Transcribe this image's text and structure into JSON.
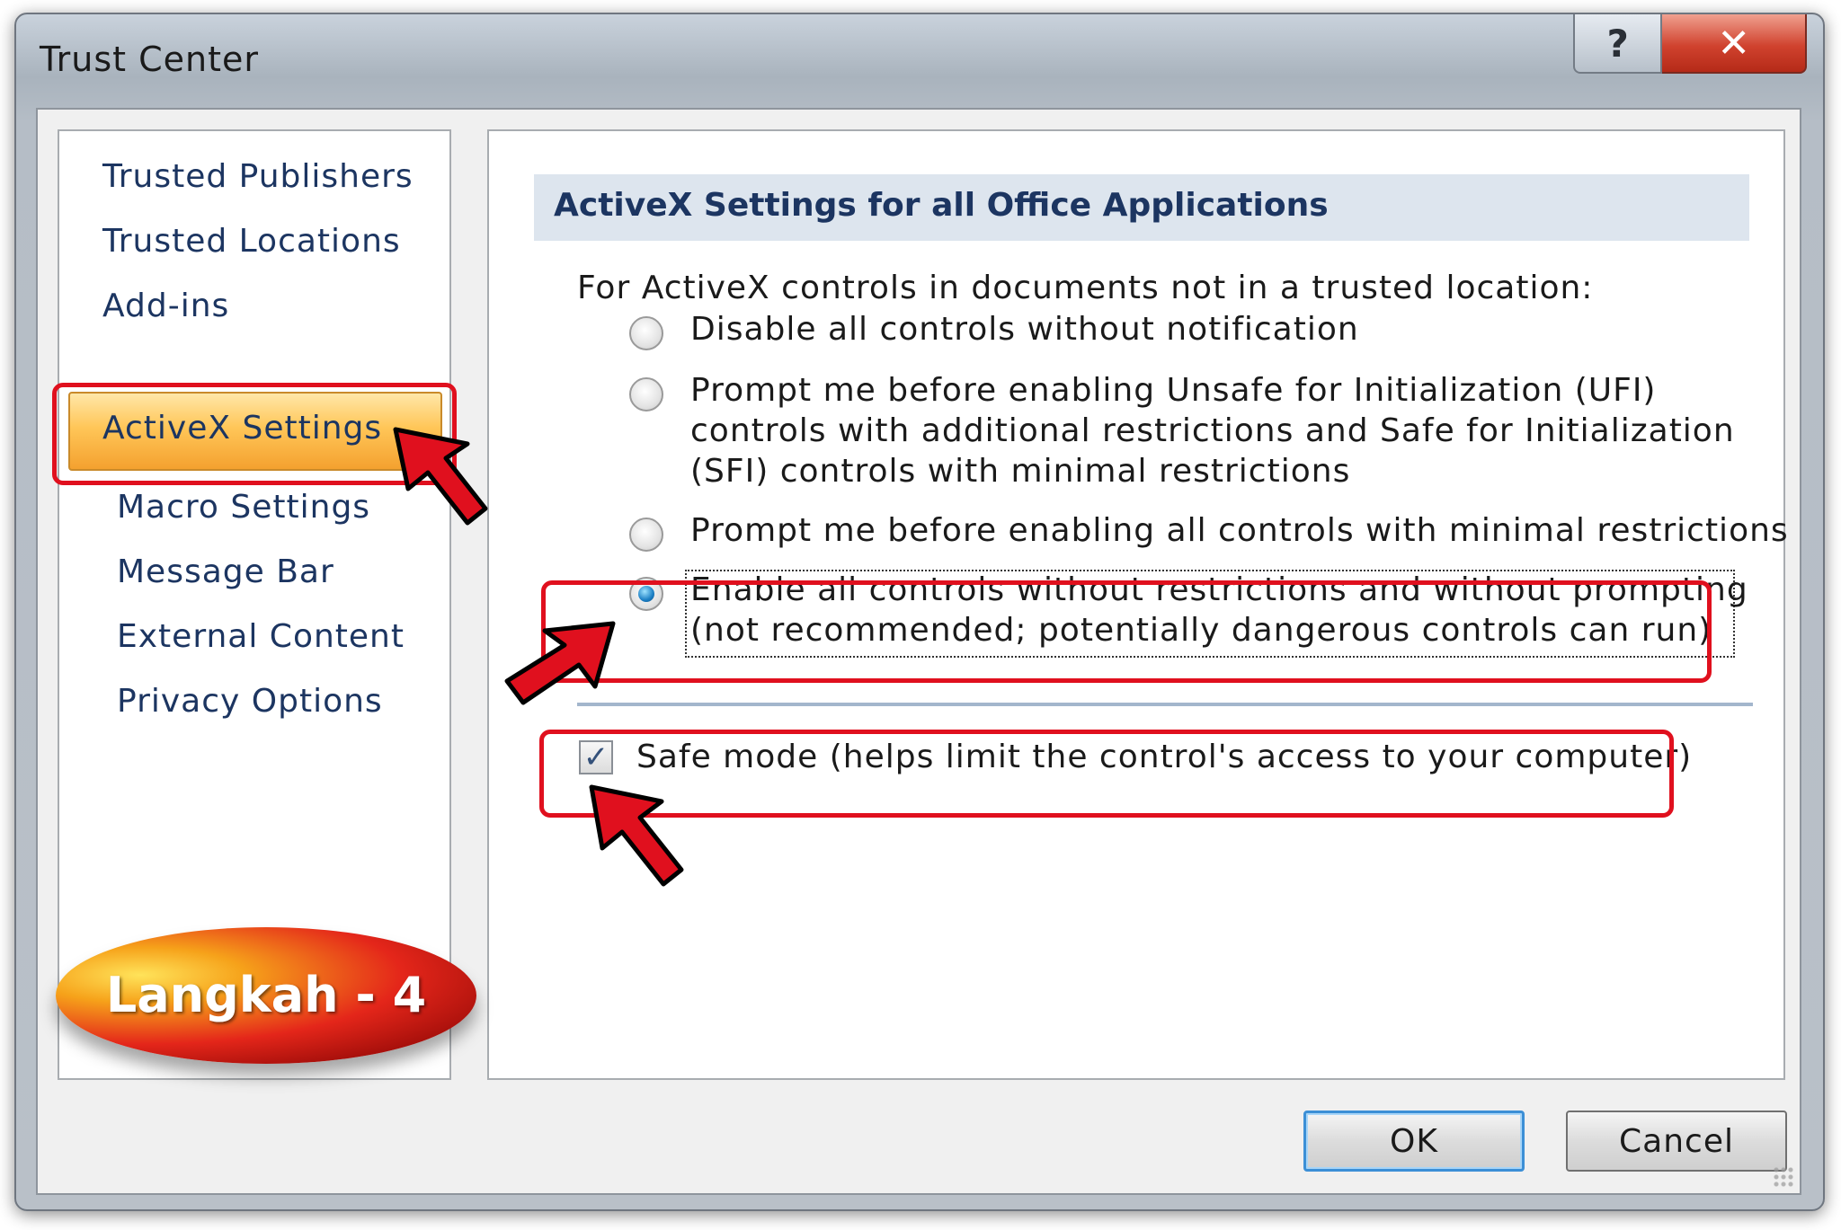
{
  "window": {
    "title": "Trust Center",
    "help_glyph": "?",
    "close_glyph": "✕"
  },
  "sidebar": {
    "items": [
      {
        "label": "Trusted Publishers"
      },
      {
        "label": "Trusted Locations"
      },
      {
        "label": "Add-ins"
      },
      {
        "label": "ActiveX Settings",
        "selected": true
      },
      {
        "label": "Macro Settings"
      },
      {
        "label": "Message Bar"
      },
      {
        "label": "External Content"
      },
      {
        "label": "Privacy Options"
      }
    ]
  },
  "main": {
    "section_title": "ActiveX Settings for all Office Applications",
    "intro": "For ActiveX controls in documents not in a trusted location:",
    "options": [
      {
        "lines": [
          "Disable all controls without notification"
        ],
        "checked": false
      },
      {
        "lines": [
          "Prompt me before enabling Unsafe for Initialization (UFI)",
          "controls with additional restrictions and Safe for Initialization",
          "(SFI) controls with minimal restrictions"
        ],
        "checked": false
      },
      {
        "lines": [
          "Prompt me before enabling all controls with minimal restrictions"
        ],
        "checked": false
      },
      {
        "lines": [
          "Enable all controls without restrictions and without prompting",
          "(not recommended; potentially dangerous controls can run)"
        ],
        "checked": true
      }
    ],
    "safe_mode": {
      "label": "Safe mode (helps limit the control's access to your computer)",
      "checked": true,
      "check_glyph": "✓"
    }
  },
  "buttons": {
    "ok": "OK",
    "cancel": "Cancel"
  },
  "annotation": {
    "badge_text": "Langkah - 4",
    "highlight_color": "#e0101e"
  }
}
